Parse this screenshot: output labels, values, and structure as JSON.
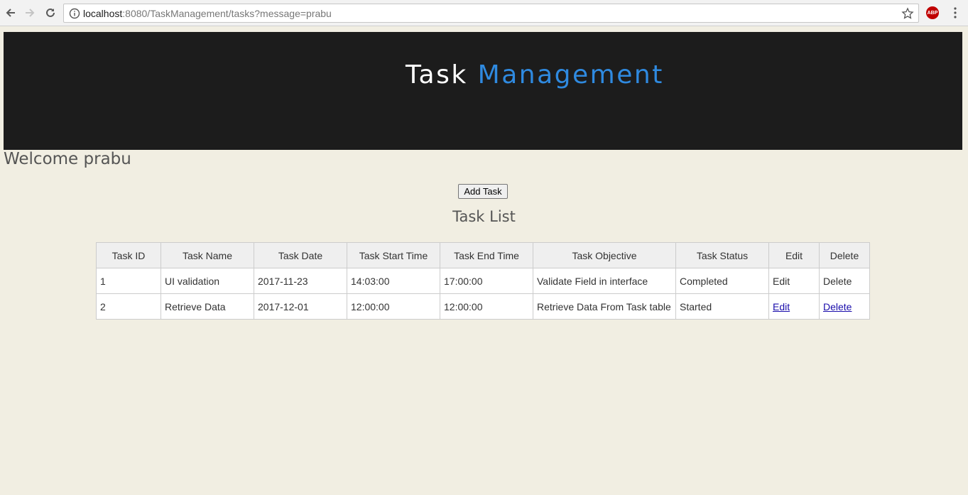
{
  "browser": {
    "url_host": "localhost",
    "url_rest": ":8080/TaskManagement/tasks?message=prabu",
    "extension_label": "ABP"
  },
  "header": {
    "title_word1": "Task",
    "title_word2": "Management",
    "accent_color": "#2f8ae0"
  },
  "welcome_text": "Welcome prabu",
  "add_task_label": "Add Task",
  "task_list_title": "Task List",
  "table": {
    "columns": [
      "Task ID",
      "Task Name",
      "Task Date",
      "Task Start Time",
      "Task End Time",
      "Task Objective",
      "Task Status",
      "Edit",
      "Delete"
    ],
    "rows": [
      {
        "id": "1",
        "name": "UI validation",
        "date": "2017-11-23",
        "start": "14:03:00",
        "end": "17:00:00",
        "objective": "Validate Field in interface",
        "status": "Completed",
        "edit": "Edit",
        "delete": "Delete"
      },
      {
        "id": "2",
        "name": "Retrieve Data",
        "date": "2017-12-01",
        "start": "12:00:00",
        "end": "12:00:00",
        "objective": "Retrieve Data From Task table",
        "status": "Started",
        "edit": "Edit",
        "delete": "Delete"
      }
    ]
  }
}
